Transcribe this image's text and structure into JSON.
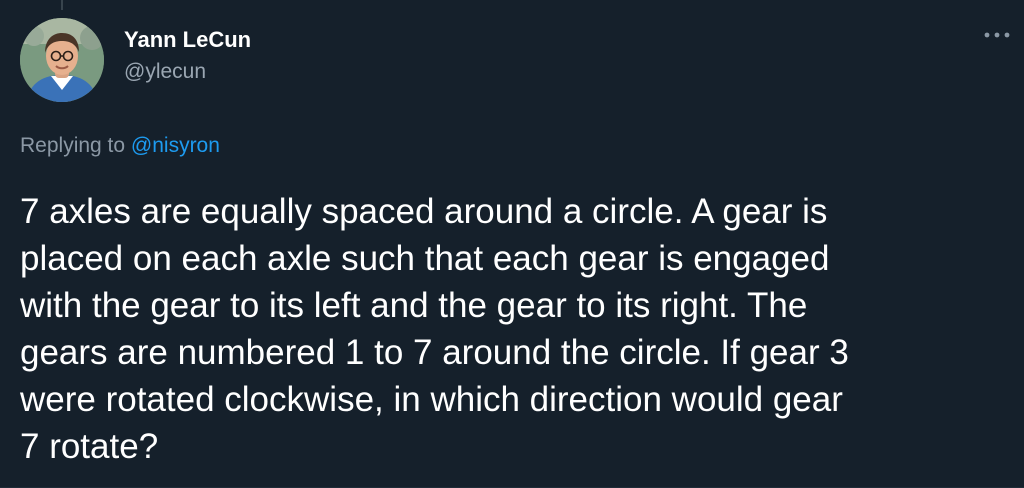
{
  "author": {
    "display_name": "Yann LeCun",
    "handle": "@ylecun"
  },
  "icons": {
    "avatar": "profile-photo",
    "more": "more-icon"
  },
  "reply": {
    "prefix": "Replying to",
    "mention": "@nisyron"
  },
  "tweet": {
    "lines": [
      "7 axles are equally spaced around a circle. A gear is",
      "placed on each axle such that each gear is engaged",
      "with the gear to its left and the gear to its right. The",
      "gears are numbered 1 to 7 around the circle. If gear 3",
      "were rotated clockwise, in which direction would gear",
      "7 rotate?"
    ]
  },
  "colors": {
    "background": "#15202b",
    "primary_text": "#ffffff",
    "secondary_text": "#8b98a5",
    "accent": "#1d9bf0"
  }
}
